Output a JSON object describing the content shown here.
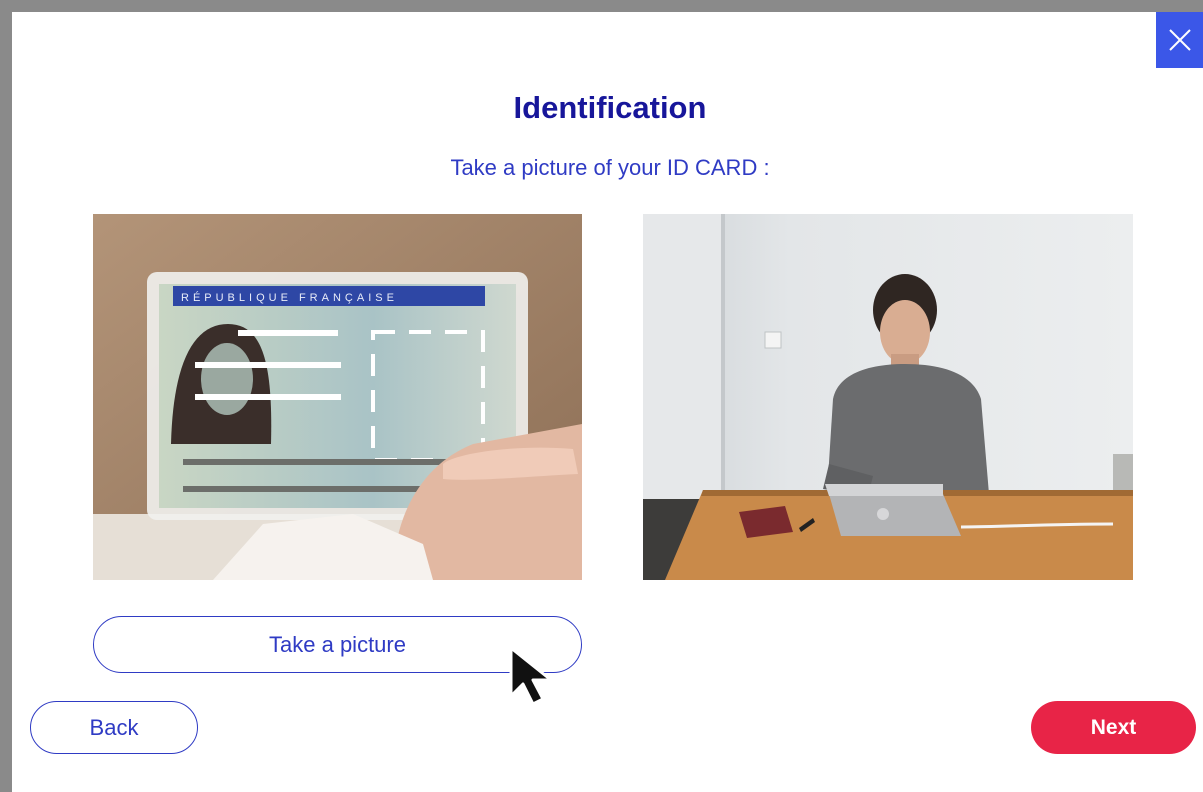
{
  "dialog": {
    "title": "Identification",
    "subtitle": "Take a picture of your ID CARD :",
    "close_icon": "close-icon"
  },
  "images": {
    "id_card": {
      "card_header_text": "RÉPUBLIQUE FRANÇAISE"
    }
  },
  "buttons": {
    "take_picture_label": "Take a picture",
    "back_label": "Back",
    "next_label": "Next"
  },
  "colors": {
    "title": "#17169a",
    "accent_blue": "#2f3bc4",
    "close_bg": "#3b57e8",
    "next_bg": "#e82447"
  }
}
